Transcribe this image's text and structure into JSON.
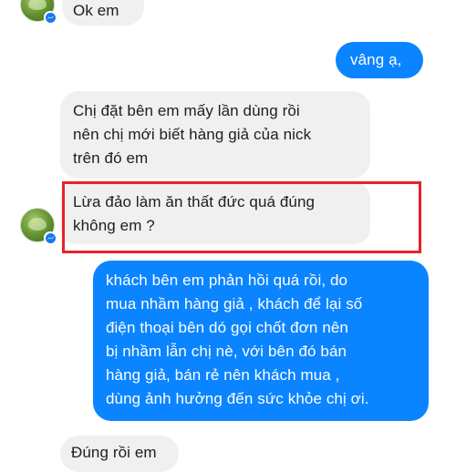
{
  "conversation": {
    "messages": [
      {
        "sender": "contact",
        "text": "Ok em"
      },
      {
        "sender": "me",
        "text": "vâng ạ,"
      },
      {
        "sender": "contact",
        "text": "Chị đặt bên em mấy lần dùng rồi\nnên chị mới biết hàng giả của nick\ntrên đó em"
      },
      {
        "sender": "contact",
        "text": "Lừa đảo làm ăn thất đức quá đúng\nkhông em ?"
      },
      {
        "sender": "me",
        "text": "khách bên em phản hồi quá rồi, do\nmua nhầm hàng giả , khách để lại số\nđiện thoại bên dó gọi chốt đơn nên\nbị nhầm lẫn chị nè, với bên đó bán\nhàng giả, bán rẻ nên khách mua ,\ndùng ảnh hưởng đến sức khỏe chị ơi."
      },
      {
        "sender": "contact",
        "text": "Đúng rồi em"
      }
    ]
  },
  "colors": {
    "incoming_bubble": "#f0f0f0",
    "outgoing_bubble": "#0b84ff",
    "highlight_border": "#e8222a",
    "messenger_badge": "#1877f2"
  },
  "icons": {
    "avatar": "contact-avatar",
    "badge": "messenger-icon"
  }
}
